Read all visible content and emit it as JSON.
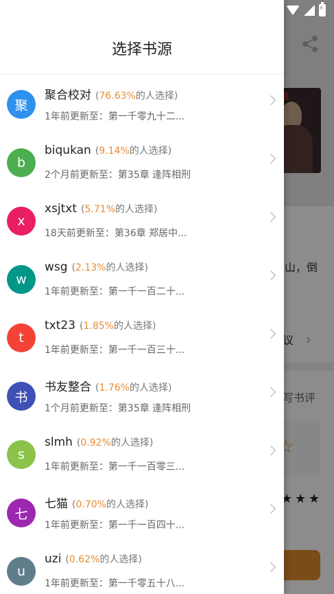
{
  "drawer": {
    "title": "选择书源",
    "sources": [
      {
        "avatar": "聚",
        "color": "#2f91ee",
        "name": "聚合校对",
        "pct": "76.63%",
        "suffix": "的人选择)",
        "sub": "1年前更新至：第一千零九十二..."
      },
      {
        "avatar": "b",
        "color": "#4cae4f",
        "name": "biqukan",
        "pct": "9.14%",
        "suffix": "的人选择)",
        "sub": "2个月前更新至：第35章 逢阵相刑"
      },
      {
        "avatar": "x",
        "color": "#e91e63",
        "name": "xsjtxt",
        "pct": "5.71%",
        "suffix": "的人选择)",
        "sub": "18天前更新至：第36章 郑居中..."
      },
      {
        "avatar": "w",
        "color": "#009688",
        "name": "wsg",
        "pct": "2.13%",
        "suffix": "的人选择)",
        "sub": "1年前更新至：第一千一百二十..."
      },
      {
        "avatar": "t",
        "color": "#f44336",
        "name": "txt23",
        "pct": "1.85%",
        "suffix": "的人选择)",
        "sub": "1年前更新至：第一千一百三十..."
      },
      {
        "avatar": "书",
        "color": "#3f51b5",
        "name": "书友整合",
        "pct": "1.76%",
        "suffix": "的人选择)",
        "sub": "1个月前更新至：第35章 逢阵相刑"
      },
      {
        "avatar": "s",
        "color": "#8bc34a",
        "name": "slmh",
        "pct": "0.92%",
        "suffix": "的人选择)",
        "sub": "1年前更新至：第一千一百零三..."
      },
      {
        "avatar": "七",
        "color": "#9c27b0",
        "name": "七猫",
        "pct": "0.70%",
        "suffix": "的人选择)",
        "sub": "1年前更新至：第一千一百四十..."
      },
      {
        "avatar": "u",
        "color": "#607d8b",
        "name": "uzi",
        "pct": "0.62%",
        "suffix": "的人选择)",
        "sub": "1年前更新至：第一千零五十八..."
      }
    ]
  },
  "background": {
    "text_mountain": "山，倒",
    "text_suggest": "议",
    "text_write_review": "写书评"
  }
}
